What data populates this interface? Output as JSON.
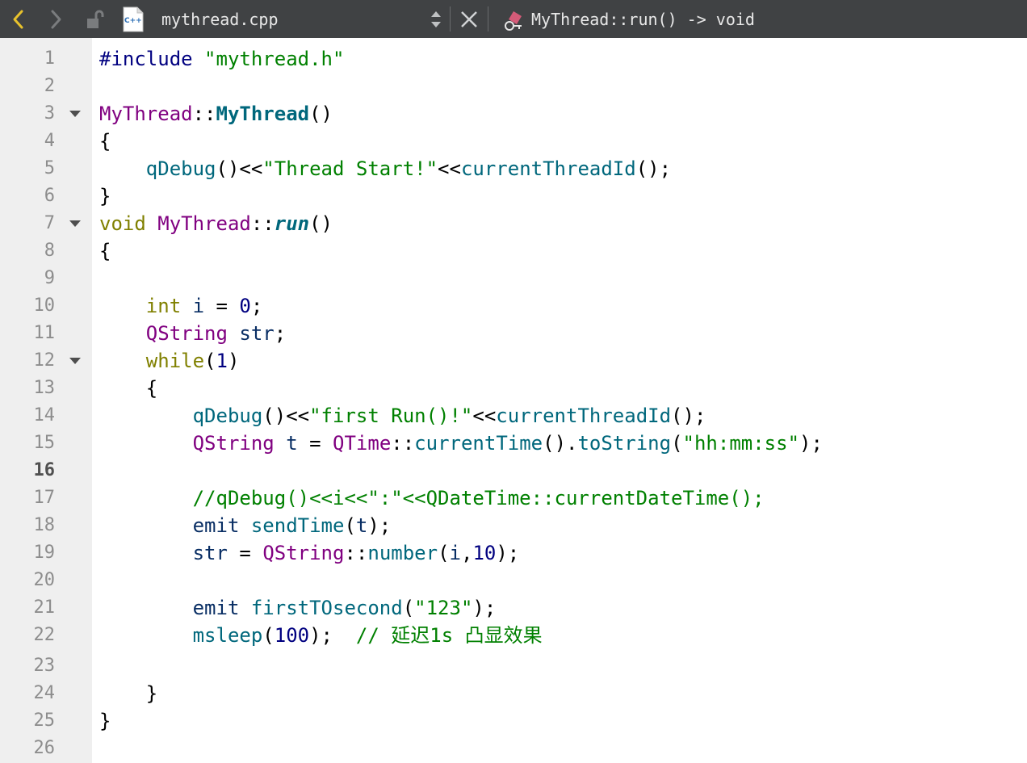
{
  "toolbar": {
    "filename": "mythread.cpp",
    "symbol": "MyThread::run() -> void",
    "icons": {
      "back": "chevron-left-icon",
      "forward": "chevron-right-icon",
      "lock": "lock-icon",
      "file": "cpp-file-icon",
      "updown": "updown-arrows-icon",
      "close": "close-icon",
      "symbol": "class-method-icon"
    },
    "file_icon_label": "C++"
  },
  "colors": {
    "keyword": "#808000",
    "type": "#800080",
    "string": "#008000",
    "function": "#00677c",
    "number": "#000080",
    "comment": "#008000",
    "operator": "#000000",
    "local": "#092e64",
    "gutter_bg": "#efefef",
    "toolbar_bg": "#404244",
    "accent_back": "#e8c22c"
  },
  "editor": {
    "current_line": 16,
    "lines": [
      {
        "n": 1,
        "fold": false,
        "tokens": [
          {
            "t": "#include",
            "c": "kw_pp"
          },
          {
            "t": " ",
            "c": "plain"
          },
          {
            "t": "\"mythread.h\"",
            "c": "string"
          }
        ]
      },
      {
        "n": 2,
        "fold": false,
        "tokens": []
      },
      {
        "n": 3,
        "fold": true,
        "tokens": [
          {
            "t": "MyThread",
            "c": "type"
          },
          {
            "t": "::",
            "c": "plain"
          },
          {
            "t": "MyThread",
            "c": "func_bold"
          },
          {
            "t": "()",
            "c": "plain"
          }
        ]
      },
      {
        "n": 4,
        "fold": false,
        "tokens": [
          {
            "t": "{",
            "c": "plain"
          }
        ]
      },
      {
        "n": 5,
        "fold": false,
        "tokens": [
          {
            "t": "    ",
            "c": "plain"
          },
          {
            "t": "qDebug",
            "c": "func"
          },
          {
            "t": "()<<",
            "c": "plain"
          },
          {
            "t": "\"Thread Start!\"",
            "c": "string"
          },
          {
            "t": "<<",
            "c": "plain"
          },
          {
            "t": "currentThreadId",
            "c": "func"
          },
          {
            "t": "();",
            "c": "plain"
          }
        ]
      },
      {
        "n": 6,
        "fold": false,
        "tokens": [
          {
            "t": "}",
            "c": "plain"
          }
        ]
      },
      {
        "n": 7,
        "fold": true,
        "tokens": [
          {
            "t": "void",
            "c": "keyword"
          },
          {
            "t": " ",
            "c": "plain"
          },
          {
            "t": "MyThread",
            "c": "type"
          },
          {
            "t": "::",
            "c": "plain"
          },
          {
            "t": "run",
            "c": "func_bold_italic"
          },
          {
            "t": "()",
            "c": "plain"
          }
        ]
      },
      {
        "n": 8,
        "fold": false,
        "tokens": [
          {
            "t": "{",
            "c": "plain"
          }
        ]
      },
      {
        "n": 9,
        "fold": false,
        "tokens": []
      },
      {
        "n": 10,
        "fold": false,
        "tokens": [
          {
            "t": "    ",
            "c": "plain"
          },
          {
            "t": "int",
            "c": "keyword"
          },
          {
            "t": " ",
            "c": "plain"
          },
          {
            "t": "i",
            "c": "local"
          },
          {
            "t": " = ",
            "c": "plain"
          },
          {
            "t": "0",
            "c": "number"
          },
          {
            "t": ";",
            "c": "plain"
          }
        ]
      },
      {
        "n": 11,
        "fold": false,
        "tokens": [
          {
            "t": "    ",
            "c": "plain"
          },
          {
            "t": "QString",
            "c": "type"
          },
          {
            "t": " ",
            "c": "plain"
          },
          {
            "t": "str",
            "c": "local"
          },
          {
            "t": ";",
            "c": "plain"
          }
        ]
      },
      {
        "n": 12,
        "fold": true,
        "tokens": [
          {
            "t": "    ",
            "c": "plain"
          },
          {
            "t": "while",
            "c": "keyword"
          },
          {
            "t": "(",
            "c": "plain"
          },
          {
            "t": "1",
            "c": "number"
          },
          {
            "t": ")",
            "c": "plain"
          }
        ]
      },
      {
        "n": 13,
        "fold": false,
        "tokens": [
          {
            "t": "    {",
            "c": "plain"
          }
        ]
      },
      {
        "n": 14,
        "fold": false,
        "tokens": [
          {
            "t": "        ",
            "c": "plain"
          },
          {
            "t": "qDebug",
            "c": "func"
          },
          {
            "t": "()<<",
            "c": "plain"
          },
          {
            "t": "\"first Run()!\"",
            "c": "string"
          },
          {
            "t": "<<",
            "c": "plain"
          },
          {
            "t": "currentThreadId",
            "c": "func"
          },
          {
            "t": "();",
            "c": "plain"
          }
        ]
      },
      {
        "n": 15,
        "fold": false,
        "tokens": [
          {
            "t": "        ",
            "c": "plain"
          },
          {
            "t": "QString",
            "c": "type"
          },
          {
            "t": " ",
            "c": "plain"
          },
          {
            "t": "t",
            "c": "local"
          },
          {
            "t": " = ",
            "c": "plain"
          },
          {
            "t": "QTime",
            "c": "type"
          },
          {
            "t": "::",
            "c": "plain"
          },
          {
            "t": "currentTime",
            "c": "func"
          },
          {
            "t": "().",
            "c": "plain"
          },
          {
            "t": "toString",
            "c": "func"
          },
          {
            "t": "(",
            "c": "plain"
          },
          {
            "t": "\"hh:mm:ss\"",
            "c": "string"
          },
          {
            "t": ");",
            "c": "plain"
          }
        ]
      },
      {
        "n": 16,
        "fold": false,
        "tokens": []
      },
      {
        "n": 17,
        "fold": false,
        "tokens": [
          {
            "t": "        ",
            "c": "plain"
          },
          {
            "t": "//qDebug()<<i<<\":\"<<QDateTime::currentDateTime();",
            "c": "comment"
          }
        ]
      },
      {
        "n": 18,
        "fold": false,
        "tokens": [
          {
            "t": "        ",
            "c": "plain"
          },
          {
            "t": "emit",
            "c": "local"
          },
          {
            "t": " ",
            "c": "plain"
          },
          {
            "t": "sendTime",
            "c": "func"
          },
          {
            "t": "(",
            "c": "plain"
          },
          {
            "t": "t",
            "c": "local"
          },
          {
            "t": ");",
            "c": "plain"
          }
        ]
      },
      {
        "n": 19,
        "fold": false,
        "tokens": [
          {
            "t": "        ",
            "c": "plain"
          },
          {
            "t": "str",
            "c": "local"
          },
          {
            "t": " = ",
            "c": "plain"
          },
          {
            "t": "QString",
            "c": "type"
          },
          {
            "t": "::",
            "c": "plain"
          },
          {
            "t": "number",
            "c": "func"
          },
          {
            "t": "(",
            "c": "plain"
          },
          {
            "t": "i",
            "c": "local"
          },
          {
            "t": ",",
            "c": "plain"
          },
          {
            "t": "10",
            "c": "number"
          },
          {
            "t": ");",
            "c": "plain"
          }
        ]
      },
      {
        "n": 20,
        "fold": false,
        "tokens": []
      },
      {
        "n": 21,
        "fold": false,
        "tokens": [
          {
            "t": "        ",
            "c": "plain"
          },
          {
            "t": "emit",
            "c": "local"
          },
          {
            "t": " ",
            "c": "plain"
          },
          {
            "t": "firstTOsecond",
            "c": "func"
          },
          {
            "t": "(",
            "c": "plain"
          },
          {
            "t": "\"123\"",
            "c": "string"
          },
          {
            "t": ");",
            "c": "plain"
          }
        ]
      },
      {
        "n": 22,
        "fold": false,
        "tokens": [
          {
            "t": "        ",
            "c": "plain"
          },
          {
            "t": "msleep",
            "c": "func"
          },
          {
            "t": "(",
            "c": "plain"
          },
          {
            "t": "100",
            "c": "number"
          },
          {
            "t": ");  ",
            "c": "plain"
          },
          {
            "t": "// 延迟1s 凸显效果",
            "c": "comment"
          }
        ]
      },
      {
        "n": 23,
        "fold": false,
        "tokens": []
      },
      {
        "n": 24,
        "fold": false,
        "tokens": [
          {
            "t": "    }",
            "c": "plain"
          }
        ]
      },
      {
        "n": 25,
        "fold": false,
        "tokens": [
          {
            "t": "}",
            "c": "plain"
          }
        ]
      },
      {
        "n": 26,
        "fold": false,
        "tokens": []
      }
    ]
  }
}
